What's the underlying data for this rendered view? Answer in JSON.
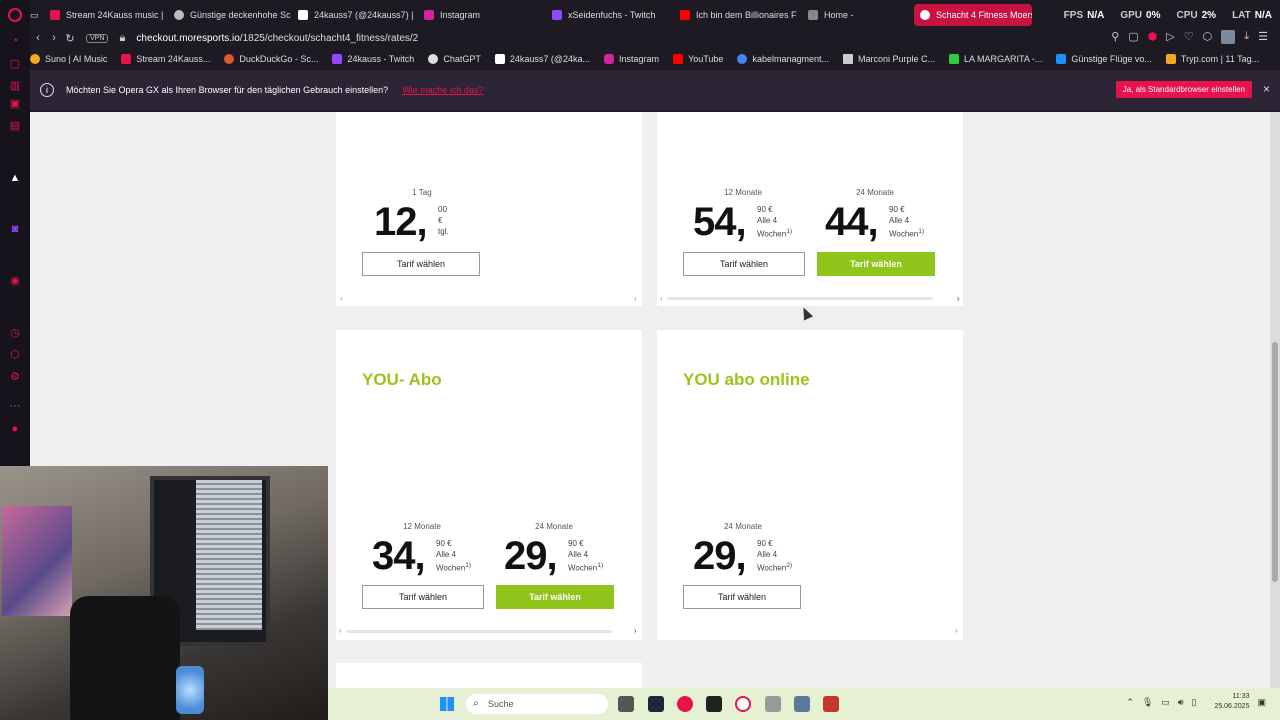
{
  "browser": {
    "tabs": [
      {
        "title": "Stream 24Kauss music |",
        "color": "#e8124c"
      },
      {
        "title": "Günstige deckenhohe Sc",
        "color": "#bbbbbb"
      },
      {
        "title": "24kauss7 (@24kauss7) |",
        "color": "#ffffff"
      },
      {
        "title": "Instagram",
        "color": "#d6249f"
      },
      {
        "title": "xSeidenfuchs - Twitch",
        "color": "#9146ff"
      },
      {
        "title": "Ich bin dem Billionaires F",
        "color": "#ff0000"
      },
      {
        "title": "Home -",
        "color": "#888888"
      },
      {
        "title": "Schacht 4 Fitness Moers",
        "color": "#ffffff"
      }
    ],
    "hud": {
      "fps_label": "FPS",
      "fps_value": "N/A",
      "gpu_label": "GPU",
      "gpu_value": "0%",
      "cpu_label": "CPU",
      "cpu_value": "2%",
      "lat_label": "LAT",
      "lat_value": "N/A"
    },
    "vpn_label": "VPN",
    "url_host": "checkout.moresports.io",
    "url_path": "/1825/checkout/schacht4_fitness/rates/2",
    "bookmarks": [
      {
        "label": "Suno | AI Music",
        "color": "#f5a623"
      },
      {
        "label": "Stream 24Kauss...",
        "color": "#e8124c"
      },
      {
        "label": "DuckDuckGo - Sc...",
        "color": "#de5833"
      },
      {
        "label": "24kauss - Twitch",
        "color": "#9146ff"
      },
      {
        "label": "ChatGPT",
        "color": "#dddddd"
      },
      {
        "label": "24kauss7 (@24ka...",
        "color": "#ffffff"
      },
      {
        "label": "Instagram",
        "color": "#d6249f"
      },
      {
        "label": "YouTube",
        "color": "#ff0000"
      },
      {
        "label": "kabelmanagment...",
        "color": "#4285f4"
      },
      {
        "label": "Marconi Purple C...",
        "color": "#cccccc"
      },
      {
        "label": "LA MARGARITA -...",
        "color": "#2ecc40"
      },
      {
        "label": "Günstige Flüge vo...",
        "color": "#1e90ff"
      },
      {
        "label": "Tryp.com | 11 Tag...",
        "color": "#f5a623"
      }
    ],
    "banner": {
      "info_icon": "i",
      "text": "Möchten Sie Opera GX als Ihren Browser für den täglichen Gebrauch einstellen?",
      "link": "Wie mache ich das?",
      "cta": "Ja, als Standardbrowser einstellen",
      "close": "×"
    }
  },
  "page": {
    "cards_top": [
      {
        "prices": [
          {
            "term": "1 Tag",
            "amount": "12,",
            "cents": "00 €",
            "period": "tgl.",
            "button": "Tarif wählen"
          }
        ]
      },
      {
        "prices": [
          {
            "term": "12 Monate",
            "amount": "54,",
            "cents": "90 €",
            "period": "Alle 4",
            "period2": "Wochen",
            "note": "1)",
            "button": "Tarif wählen"
          },
          {
            "term": "24 Monate",
            "amount": "44,",
            "cents": "90 €",
            "period": "Alle 4",
            "period2": "Wochen",
            "note": "1)",
            "button": "Tarif wählen"
          }
        ]
      }
    ],
    "cards_mid": [
      {
        "title": "YOU- Abo",
        "prices": [
          {
            "term": "12 Monate",
            "amount": "34,",
            "cents": "90 €",
            "period": "Alle 4",
            "period2": "Wochen",
            "note": "1)",
            "button": "Tarif wählen"
          },
          {
            "term": "24 Monate",
            "amount": "29,",
            "cents": "90 €",
            "period": "Alle 4",
            "period2": "Wochen",
            "note": "1)",
            "button": "Tarif wählen"
          }
        ]
      },
      {
        "title": "YOU abo online",
        "prices": [
          {
            "term": "24 Monate",
            "amount": "29,",
            "cents": "90 €",
            "period": "Alle 4",
            "period2": "Wochen",
            "note": "2)",
            "button": "Tarif wählen"
          }
        ]
      }
    ],
    "accent_green": "#8fc51b"
  },
  "taskbar": {
    "search_placeholder": "Suche",
    "time": "11:33",
    "date": "25.06.2025"
  }
}
